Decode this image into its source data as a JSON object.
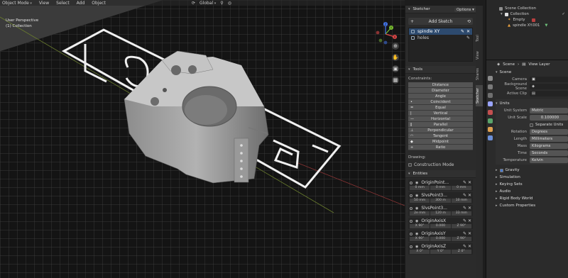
{
  "header": {
    "mode": "Object Mode",
    "menus": [
      "View",
      "Select",
      "Add",
      "Object"
    ],
    "transform": "Global",
    "options": "Options"
  },
  "viewport": {
    "perspective": "User Perspective",
    "collection": "(1) Collection",
    "floor_text": "latticore",
    "gizmo": {
      "x": "X",
      "y": "Y",
      "z": "Z"
    }
  },
  "side_tabs": [
    "Tool",
    "View",
    "Shares",
    "Sketcher"
  ],
  "sketcher": {
    "title": "Sketcher",
    "add_sketch": "Add Sketch",
    "sketches": [
      "spindle XY",
      "holes"
    ],
    "tools_title": "Tools",
    "constraints_label": "Constraints:",
    "constraints": [
      "Distance",
      "Diameter",
      "Angle",
      "Coincident",
      "Equal",
      "Vertical",
      "Horizontal",
      "Parallel",
      "Perpendicular",
      "Tangent",
      "Midpoint",
      "Ratio"
    ],
    "drawing_label": "Drawing:",
    "construction_mode": "Construction Mode",
    "entities_title": "Entities",
    "entities": [
      {
        "name": "OriginPoint...",
        "values": [
          "0 mm",
          "0 mm",
          "0 mm"
        ]
      },
      {
        "name": "SlvsPoint3...",
        "values": [
          "50 mm",
          "300 m",
          "10 mm"
        ]
      },
      {
        "name": "SlvsPoint3...",
        "values": [
          "2e mm",
          "120 m",
          "33 mm"
        ]
      },
      {
        "name": "OriginAxisX",
        "values": [
          "X 90°",
          "0.000",
          "Z 90°"
        ]
      },
      {
        "name": "OriginAxisY",
        "values": [
          "X 90°",
          "0.000",
          "Z 90°"
        ]
      },
      {
        "name": "OriginAxisZ",
        "values": [
          "X 0°",
          "Y 0°",
          "Z 0°"
        ]
      }
    ]
  },
  "outliner": {
    "root": "Scene Collection",
    "collection": "Collection",
    "items": [
      "Empty",
      "spindle XY.001"
    ]
  },
  "properties": {
    "scene": "Scene",
    "view_layer": "View Layer",
    "scene_section": "Scene",
    "camera_label": "Camera",
    "background_label": "Background Scene",
    "active_clip_label": "Active Clip",
    "units_section": "Units",
    "unit_system_label": "Unit System",
    "unit_system": "Metric",
    "unit_scale_label": "Unit Scale",
    "unit_scale": "0.100000",
    "separate_units": "Separate Units",
    "rotation_label": "Rotation",
    "rotation": "Degrees",
    "length_label": "Length",
    "length": "Millimeters",
    "mass_label": "Mass",
    "mass": "Kilograms",
    "time_label": "Time",
    "time": "Seconds",
    "temperature_label": "Temperature",
    "temperature": "Kelvin",
    "collapsed": [
      "Gravity",
      "Simulation",
      "Keying Sets",
      "Audio",
      "Rigid Body World",
      "Custom Properties"
    ]
  }
}
